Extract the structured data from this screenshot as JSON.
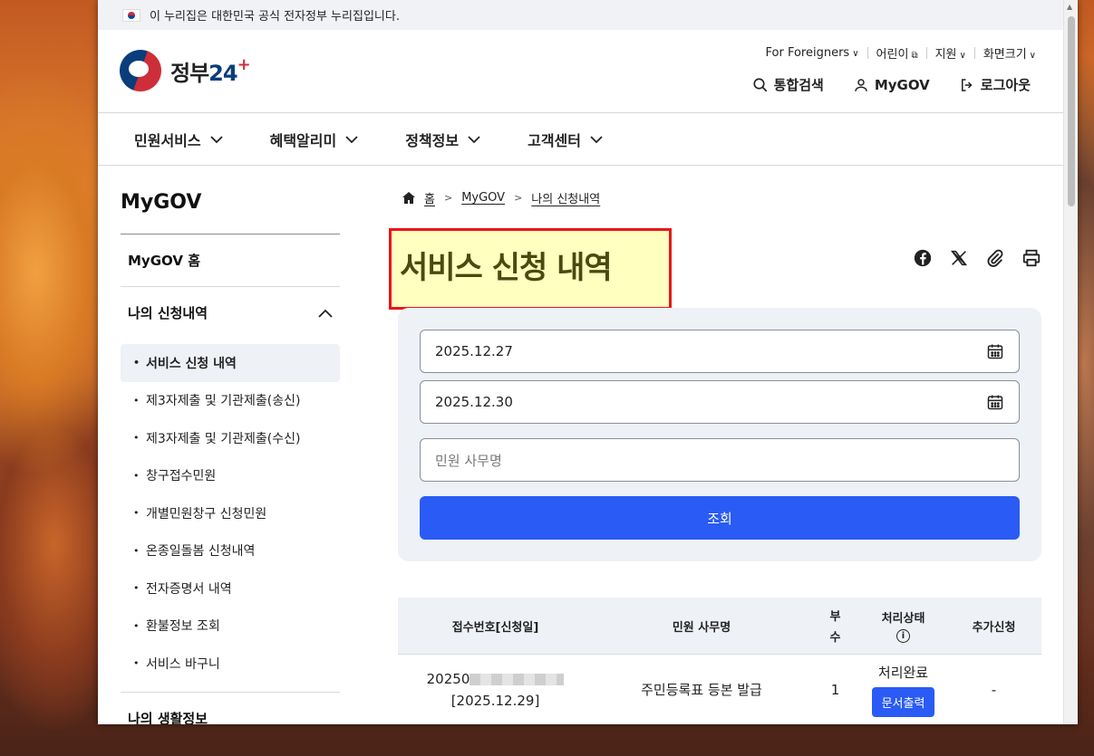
{
  "gov_banner": {
    "text": "이 누리집은 대한민국 공식 전자정부 누리집입니다."
  },
  "logo": {
    "text_main": "정부",
    "text_num": "24",
    "text_plus": "+"
  },
  "util_links": [
    {
      "label": "For Foreigners"
    },
    {
      "label": "어린이"
    },
    {
      "label": "지원"
    },
    {
      "label": "화면크기"
    }
  ],
  "main_actions": {
    "search": "통합검색",
    "mygov": "MyGOV",
    "logout": "로그아웃"
  },
  "gnb": [
    "민원서비스",
    "혜택알리미",
    "정책정보",
    "고객센터"
  ],
  "lnb": {
    "title": "MyGOV",
    "home": "MyGOV 홈",
    "section": "나의 신청내역",
    "items": [
      "서비스 신청 내역",
      "제3자제출 및 기관제출(송신)",
      "제3자제출 및 기관제출(수신)",
      "창구접수민원",
      "개별민원창구 신청민원",
      "온종일돌봄 신청내역",
      "전자증명서 내역",
      "환불정보 조회",
      "서비스 바구니"
    ],
    "next_section": "나의 생활정보"
  },
  "breadcrumb": [
    "홈",
    "MyGOV",
    "나의 신청내역"
  ],
  "page_title": "서비스 신청 내역",
  "search": {
    "start_date": "2025.12.27",
    "end_date": "2025.12.30",
    "keyword_placeholder": "민원 사무명",
    "submit": "조회"
  },
  "table": {
    "headers": {
      "receipt": "접수번호[신청일]",
      "service": "민원 사무명",
      "count_1": "부",
      "count_2": "수",
      "status": "처리상태",
      "extra": "추가신청"
    },
    "rows": [
      {
        "receipt_prefix": "20250",
        "date": "[2025.12.29]",
        "service": "주민등록표 등본 발급",
        "count": "1",
        "status": "처리완료",
        "action": "문서출력",
        "extra": "-"
      }
    ]
  }
}
